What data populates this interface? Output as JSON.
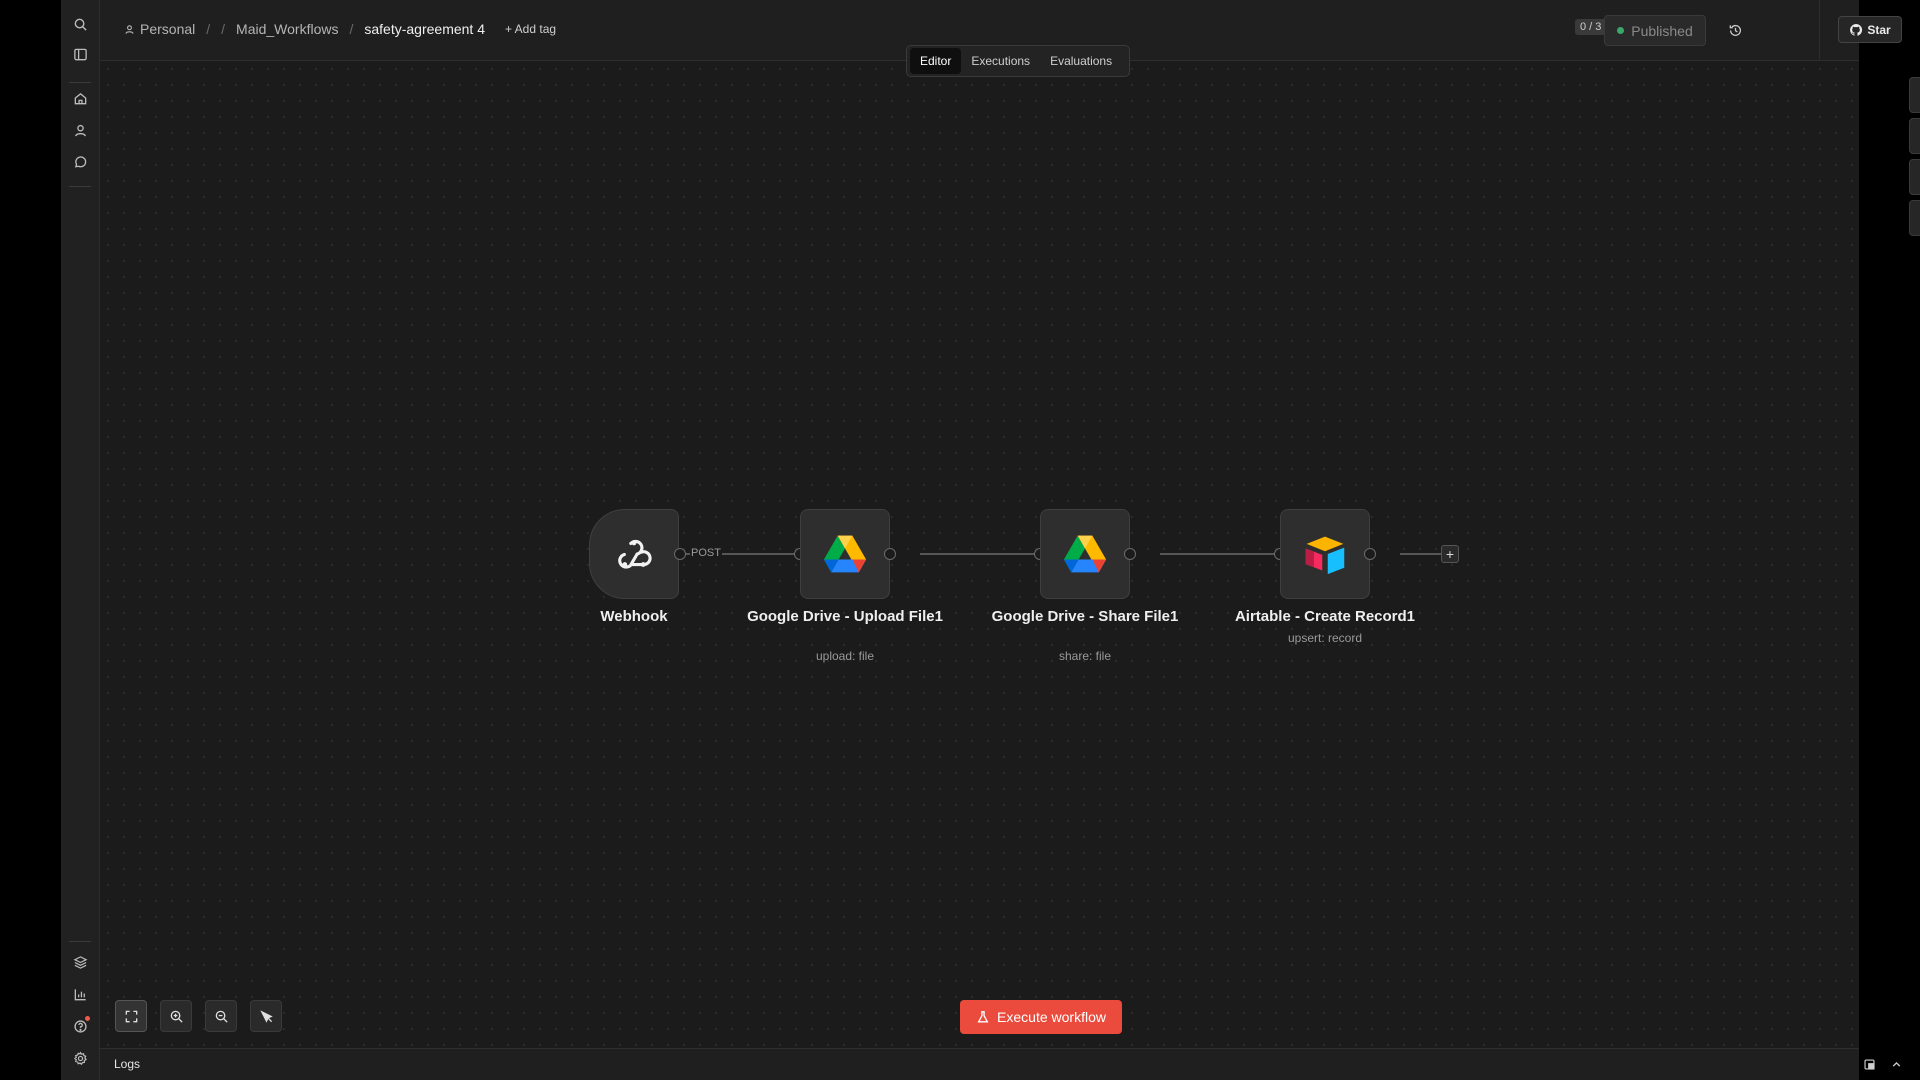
{
  "breadcrumb": {
    "personal": "Personal",
    "folder": "Maid_Workflows",
    "workflow": "safety-agreement 4",
    "add_tag": "+ Add tag"
  },
  "header": {
    "counter": "0 / 3",
    "status": "Published",
    "star_label": "Star"
  },
  "tabs": [
    {
      "label": "Editor",
      "active": true
    },
    {
      "label": "Executions",
      "active": false
    },
    {
      "label": "Evaluations",
      "active": false
    }
  ],
  "nodes": [
    {
      "title": "Webhook",
      "subtitle": "",
      "icon": "webhook-icon"
    },
    {
      "title": "Google Drive - Upload File1",
      "subtitle": "upload: file",
      "icon": "google-drive-icon"
    },
    {
      "title": "Google Drive - Share File1",
      "subtitle": "share: file",
      "icon": "google-drive-icon"
    },
    {
      "title": "Airtable - Create Record1",
      "subtitle": "upsert: record",
      "icon": "airtable-icon"
    }
  ],
  "edge_label": "POST",
  "execute_label": "Execute workflow",
  "logs_label": "Logs",
  "colors": {
    "accent": "#ea4b3c",
    "published_dot": "#3aa86b",
    "canvas_bg": "#1b1b1b"
  }
}
